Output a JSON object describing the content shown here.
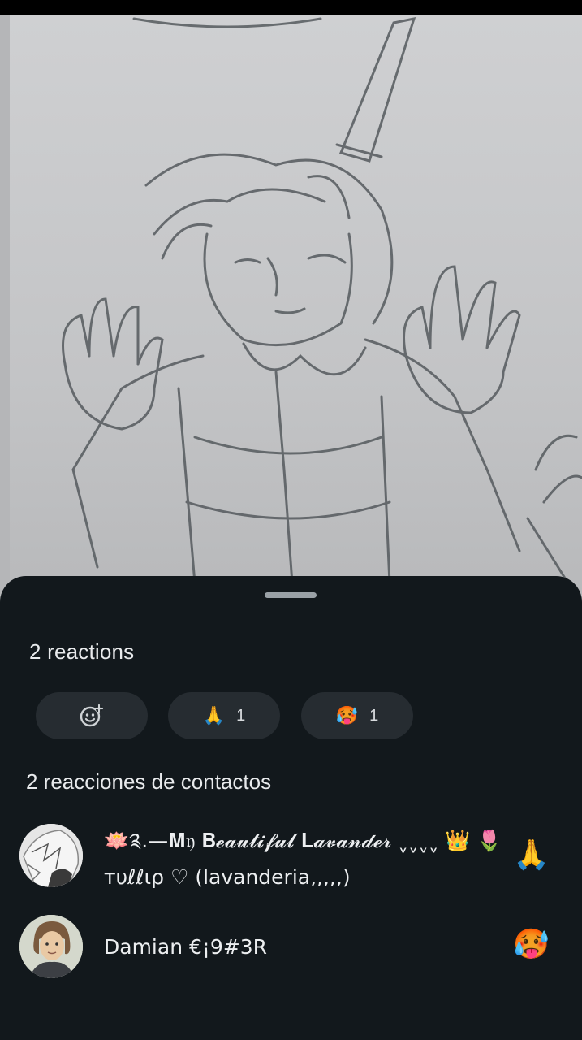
{
  "sheet": {
    "title": "2 reactions",
    "chips": [
      {
        "emoji": "🙏",
        "count": "1"
      },
      {
        "emoji": "🥵",
        "count": "1"
      }
    ],
    "section_title": "2 reacciones de contactos",
    "contacts": [
      {
        "name_line1": "🪷༉.—𝐌𝔶 𝐁𝓮𝓪𝓾𝓽𝓲𝓯𝓾𝓵 𝐋𝓪𝓿𝓪𝓷𝓭𝓮𝓻 ˬˬˬˬ 👑 🌷",
        "name_line2": "тυℓℓιρ ♡ (lavanderia,,,,,)",
        "reaction": "🙏"
      },
      {
        "name_line1": "Damian €¡9#3R",
        "reaction": "🥵"
      }
    ]
  },
  "colors": {
    "sheet_bg": "#12181c",
    "chip_bg": "#262c31",
    "text": "#e8eaec"
  },
  "icons": [
    "add-emoji-icon"
  ]
}
